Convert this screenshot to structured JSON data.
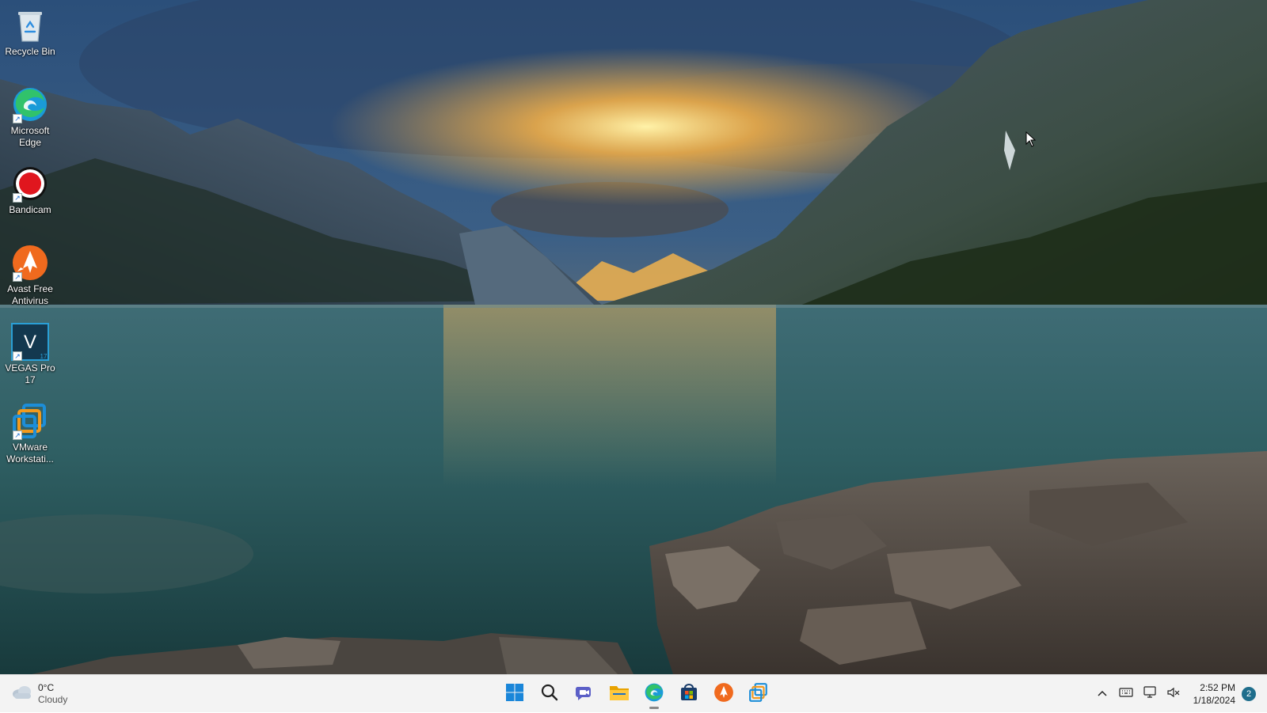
{
  "desktop": {
    "icons": [
      {
        "label": "Recycle Bin",
        "icon": "recycle-bin-icon"
      },
      {
        "label": "Microsoft Edge",
        "icon": "edge-icon"
      },
      {
        "label": "Bandicam",
        "icon": "bandicam-icon"
      },
      {
        "label": "Avast Free Antivirus",
        "icon": "avast-icon"
      },
      {
        "label": "VEGAS Pro 17",
        "icon": "vegas-icon"
      },
      {
        "label": "VMware Workstati...",
        "icon": "vmware-icon"
      }
    ]
  },
  "taskbar": {
    "weather": {
      "temperature": "0°C",
      "condition": "Cloudy",
      "icon": "cloudy-icon"
    },
    "apps": [
      {
        "name": "Start",
        "icon": "windows-start-icon"
      },
      {
        "name": "Search",
        "icon": "search-icon"
      },
      {
        "name": "Chat",
        "icon": "chat-icon"
      },
      {
        "name": "File Explorer",
        "icon": "folder-icon"
      },
      {
        "name": "Microsoft Edge",
        "icon": "edge-icon"
      },
      {
        "name": "Microsoft Store",
        "icon": "store-icon"
      },
      {
        "name": "Avast Free Antivirus",
        "icon": "avast-icon"
      },
      {
        "name": "VMware Workstation",
        "icon": "vmware-icon"
      }
    ],
    "tray": {
      "time": "2:52 PM",
      "date": "1/18/2024",
      "notification_count": "2"
    }
  },
  "colors": {
    "taskbar_bg": "#f3f3f3",
    "accent": "#0078d4"
  }
}
